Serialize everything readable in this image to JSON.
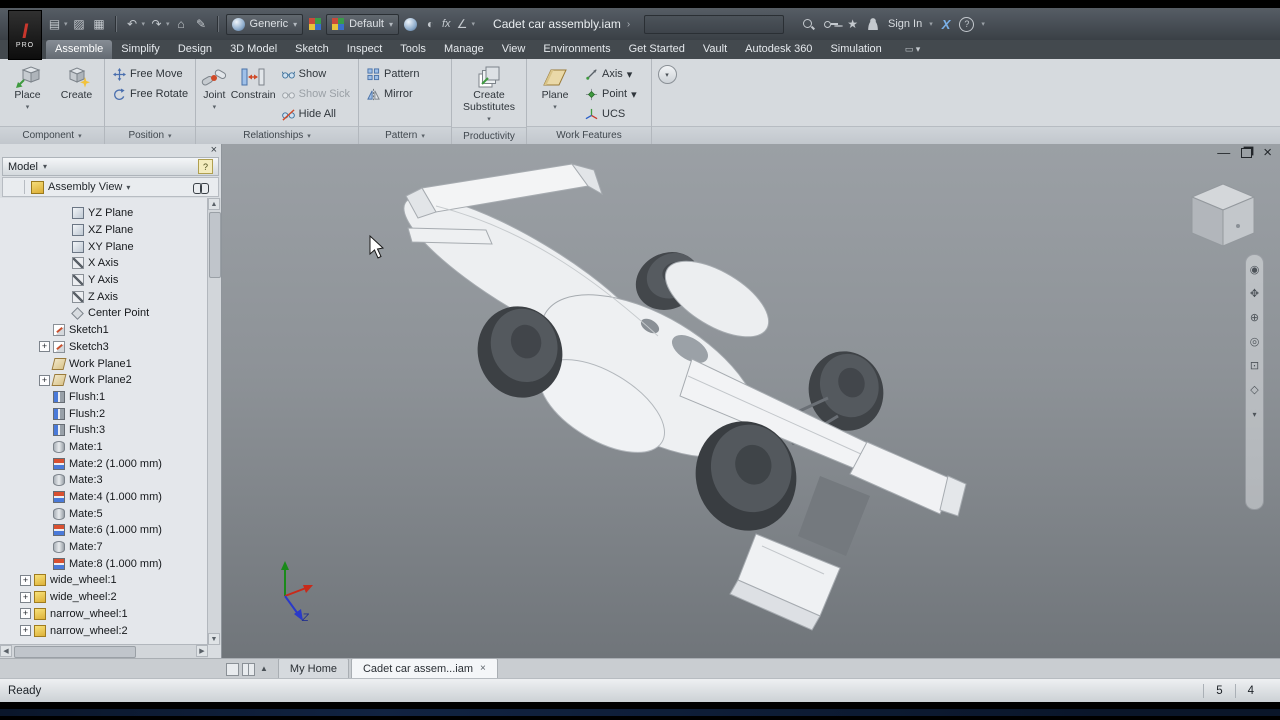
{
  "titlebar": {
    "logo_pro": "PRO",
    "material_value": "Generic",
    "appearance_value": "Default",
    "fx_label": "fx",
    "doc_title": "Cadet car assembly.iam",
    "sign_in": "Sign In"
  },
  "ribbon": {
    "active_tab": "Assemble",
    "tabs": [
      "Assemble",
      "Simplify",
      "Design",
      "3D Model",
      "Sketch",
      "Inspect",
      "Tools",
      "Manage",
      "View",
      "Environments",
      "Get Started",
      "Vault",
      "Autodesk 360",
      "Simulation"
    ],
    "component": {
      "label": "Component",
      "place": "Place",
      "create": "Create"
    },
    "position": {
      "label": "Position",
      "free_move": "Free Move",
      "free_rotate": "Free Rotate"
    },
    "relationships": {
      "label": "Relationships",
      "joint": "Joint",
      "constrain": "Constrain",
      "show": "Show",
      "show_sick": "Show Sick",
      "hide_all": "Hide All"
    },
    "pattern": {
      "label": "Pattern",
      "pattern": "Pattern",
      "mirror": "Mirror"
    },
    "productivity": {
      "label": "Productivity",
      "create_line": "Create",
      "substitutes_line": "Substitutes"
    },
    "work_features": {
      "label": "Work Features",
      "plane": "Plane",
      "axis": "Axis",
      "point": "Point",
      "ucs": "UCS"
    }
  },
  "browser": {
    "panel_title": "Model",
    "view_selector": "Assembly View",
    "tree": [
      {
        "label": "YZ Plane",
        "icon": "plane",
        "indent": 2
      },
      {
        "label": "XZ Plane",
        "icon": "plane",
        "indent": 2
      },
      {
        "label": "XY Plane",
        "icon": "plane",
        "indent": 2
      },
      {
        "label": "X Axis",
        "icon": "axis",
        "indent": 2
      },
      {
        "label": "Y Axis",
        "icon": "axis",
        "indent": 2
      },
      {
        "label": "Z Axis",
        "icon": "axis",
        "indent": 2
      },
      {
        "label": "Center Point",
        "icon": "point",
        "indent": 2
      },
      {
        "label": "Sketch1",
        "icon": "sketch",
        "indent": 1
      },
      {
        "label": "Sketch3",
        "icon": "sketch",
        "indent": 1,
        "expander": true
      },
      {
        "label": "Work Plane1",
        "icon": "workplane",
        "indent": 1
      },
      {
        "label": "Work Plane2",
        "icon": "workplane",
        "indent": 1,
        "expander": true
      },
      {
        "label": "Flush:1",
        "icon": "flush",
        "indent": 1
      },
      {
        "label": "Flush:2",
        "icon": "flush",
        "indent": 1
      },
      {
        "label": "Flush:3",
        "icon": "flush",
        "indent": 1
      },
      {
        "label": "Mate:1",
        "icon": "mate",
        "indent": 1
      },
      {
        "label": "Mate:2 (1.000 mm)",
        "icon": "matedim",
        "indent": 1
      },
      {
        "label": "Mate:3",
        "icon": "mate",
        "indent": 1
      },
      {
        "label": "Mate:4 (1.000 mm)",
        "icon": "matedim",
        "indent": 1
      },
      {
        "label": "Mate:5",
        "icon": "mate",
        "indent": 1
      },
      {
        "label": "Mate:6 (1.000 mm)",
        "icon": "matedim",
        "indent": 1
      },
      {
        "label": "Mate:7",
        "icon": "mate",
        "indent": 1
      },
      {
        "label": "Mate:8 (1.000 mm)",
        "icon": "matedim",
        "indent": 1
      },
      {
        "label": "wide_wheel:1",
        "icon": "part",
        "indent": 0,
        "expander": true
      },
      {
        "label": "wide_wheel:2",
        "icon": "part",
        "indent": 0,
        "expander": true
      },
      {
        "label": "narrow_wheel:1",
        "icon": "part",
        "indent": 0,
        "expander": true
      },
      {
        "label": "narrow_wheel:2",
        "icon": "part",
        "indent": 0,
        "expander": true
      }
    ]
  },
  "viewport": {
    "z_axis_label": "Z"
  },
  "doctabs": {
    "home_tab": "My Home",
    "document_tab": "Cadet car assem...iam"
  },
  "statusbar": {
    "message": "Ready",
    "count_a": "5",
    "count_b": "4"
  }
}
